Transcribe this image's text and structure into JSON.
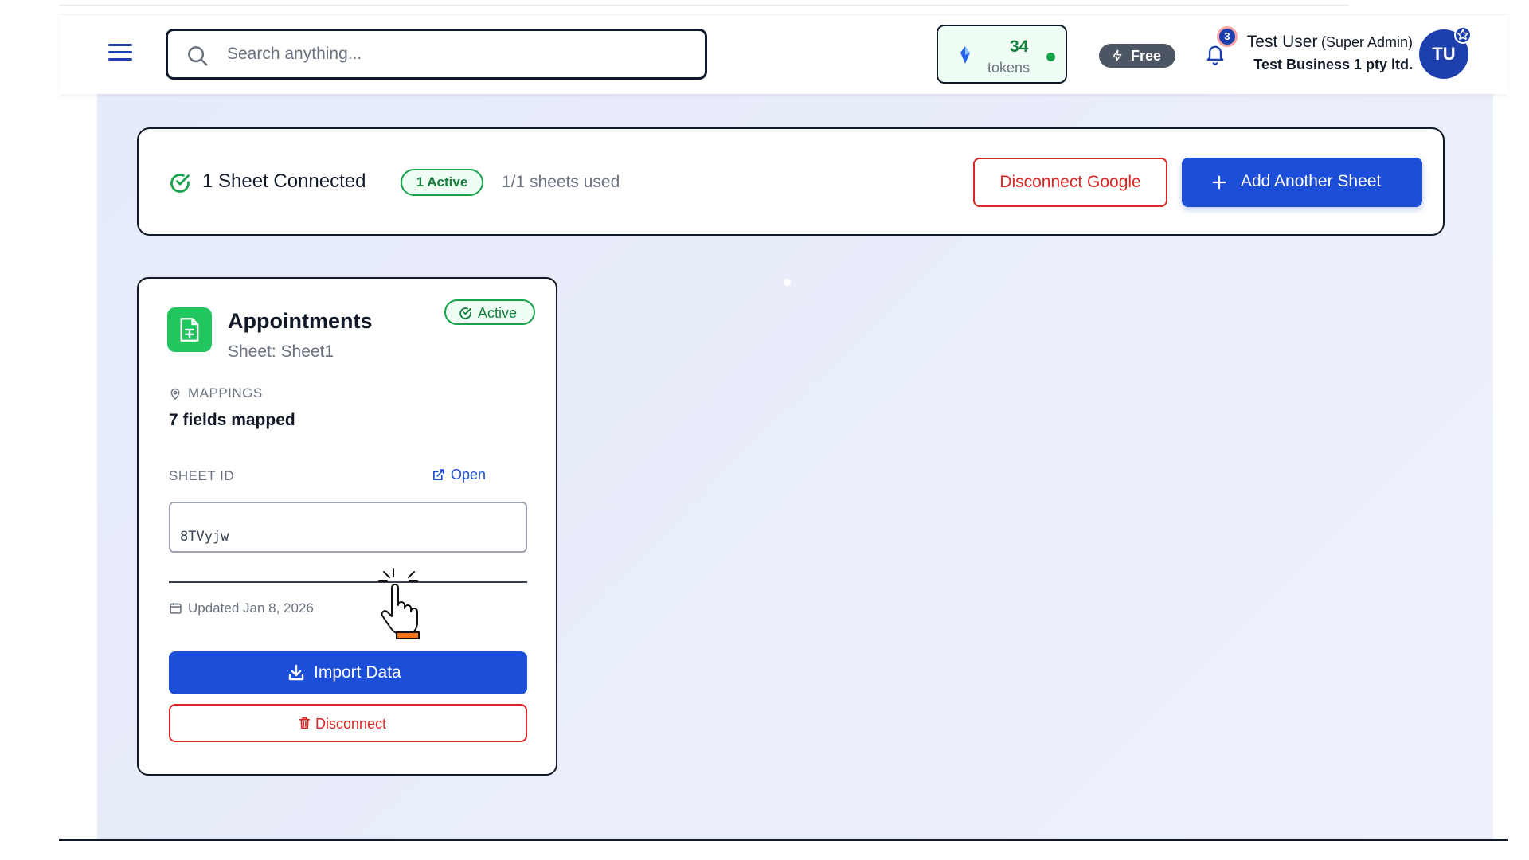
{
  "header": {
    "search_placeholder": "Search anything...",
    "tokens_count": "34",
    "tokens_label": "tokens",
    "plan_label": "Free",
    "notification_count": "3",
    "user_name": "Test User",
    "user_role": "(Super Admin)",
    "business_name": "Test Business 1 pty ltd.",
    "avatar_initials": "TU"
  },
  "summary": {
    "title": "1 Sheet Connected",
    "active_badge": "1 Active",
    "usage": "1/1 sheets used",
    "disconnect_google_label": "Disconnect Google",
    "add_sheet_label": "Add Another Sheet"
  },
  "sheet_card": {
    "name": "Appointments",
    "subtitle": "Sheet: Sheet1",
    "status": "Active",
    "mappings_label": "MAPPINGS",
    "mappings_value": "7 fields mapped",
    "sheet_id_label": "SHEET ID",
    "open_label": "Open",
    "sheet_id_value": "8TVyjw",
    "updated": "Updated Jan 8, 2026",
    "import_label": "Import Data",
    "disconnect_label": "Disconnect"
  },
  "colors": {
    "primary": "#1d4ed8",
    "danger": "#dc2626",
    "success": "#16a34a",
    "background": "#e8ecfa"
  },
  "icons": [
    "menu-icon",
    "search-icon",
    "gem-icon",
    "bolt-icon",
    "bell-icon",
    "star-icon",
    "check-circle-icon",
    "plus-icon",
    "spreadsheet-icon",
    "map-pin-icon",
    "external-link-icon",
    "calendar-icon",
    "download-icon",
    "trash-icon",
    "hand-cursor-icon"
  ]
}
